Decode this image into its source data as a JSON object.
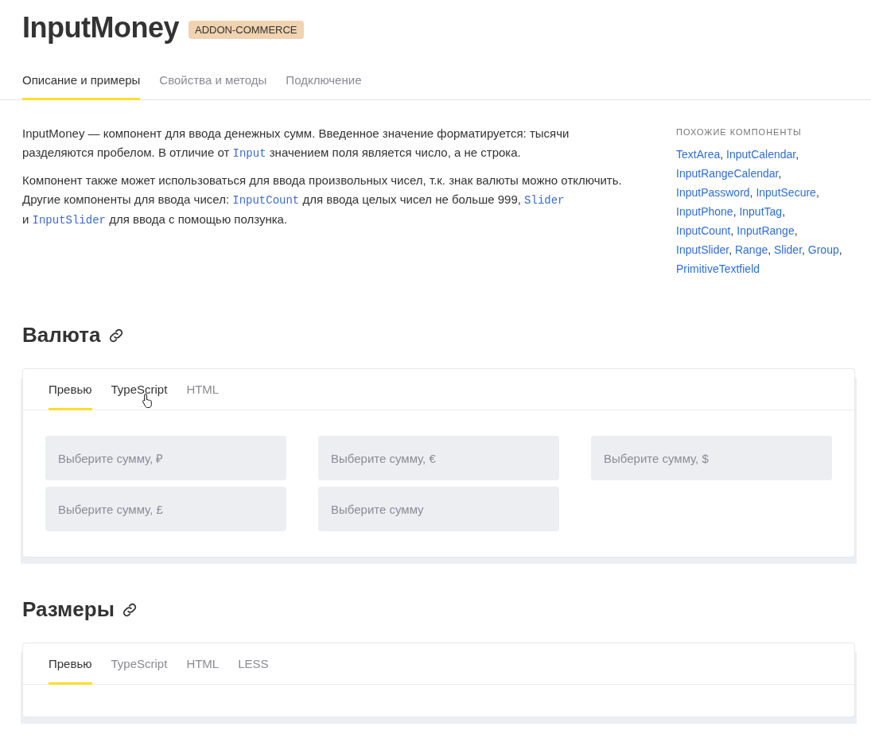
{
  "header": {
    "title": "InputMoney",
    "badge": "ADDON-COMMERCE"
  },
  "page_tabs": [
    {
      "label": "Описание и примеры",
      "selected": true
    },
    {
      "label": "Свойства и методы",
      "selected": false
    },
    {
      "label": "Подключение",
      "selected": false
    }
  ],
  "description": [
    [
      {
        "kind": "text",
        "text": "InputMoney — компонент для ввода денежных сумм. Введенное значение форматируется: тысячи разделяются пробелом. В отличие от "
      },
      {
        "kind": "code",
        "text": "Input"
      },
      {
        "kind": "text",
        "text": " значением поля является число, а не строка."
      }
    ],
    [
      {
        "kind": "text",
        "text": "Компонент также может использоваться для ввода произвольных чисел, т.к. знак валюты можно отключить. Другие компоненты для ввода чисел: "
      },
      {
        "kind": "code",
        "text": "InputCount"
      },
      {
        "kind": "text",
        "text": " для ввода целых чисел не больше 999, "
      },
      {
        "kind": "code",
        "text": "Slider"
      },
      {
        "kind": "break"
      },
      {
        "kind": "text",
        "text": "и "
      },
      {
        "kind": "code",
        "text": "InputSlider"
      },
      {
        "kind": "text",
        "text": " для ввода с помощью ползунка."
      }
    ]
  ],
  "related": {
    "heading": "ПОХОЖИЕ КОМПОНЕНТЫ",
    "lines": [
      [
        "TextArea",
        "InputCalendar"
      ],
      [
        "InputRangeCalendar"
      ],
      [
        "InputPassword",
        "InputSecure"
      ],
      [
        "InputPhone",
        "InputTag"
      ],
      [
        "InputCount",
        "InputRange"
      ],
      [
        "InputSlider",
        "Range",
        "Slider",
        "Group"
      ],
      [
        "PrimitiveTextfield"
      ]
    ],
    "separator": ","
  },
  "sections": [
    {
      "title": "Валюта",
      "tabs": [
        {
          "label": "Превью",
          "selected": true,
          "hovered": false
        },
        {
          "label": "TypeScript",
          "selected": false,
          "hovered": true
        },
        {
          "label": "HTML",
          "selected": false,
          "hovered": false
        }
      ],
      "fields": [
        {
          "placeholder": "Выберите сумму, ₽"
        },
        {
          "placeholder": "Выберите сумму, €"
        },
        {
          "placeholder": "Выберите сумму, $"
        },
        {
          "placeholder": "Выберите сумму, £"
        },
        {
          "placeholder": "Выберите сумму"
        }
      ]
    },
    {
      "title": "Размеры",
      "tabs": [
        {
          "label": "Превью",
          "selected": true,
          "hovered": false
        },
        {
          "label": "TypeScript",
          "selected": false,
          "hovered": false
        },
        {
          "label": "HTML",
          "selected": false,
          "hovered": false
        },
        {
          "label": "LESS",
          "selected": false,
          "hovered": false
        }
      ]
    }
  ]
}
